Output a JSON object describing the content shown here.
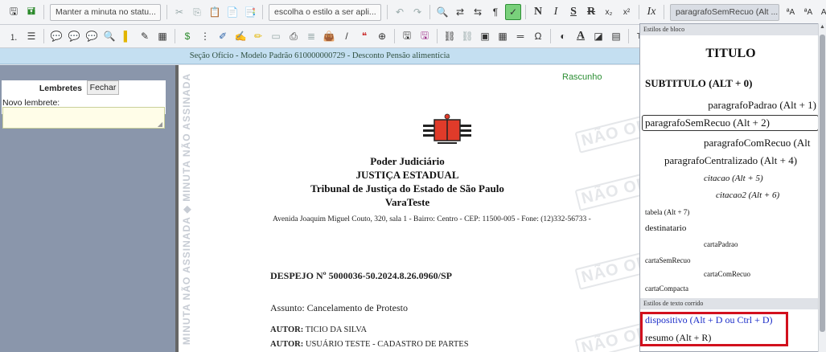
{
  "toolbar1": {
    "status_select": "Manter a minuta no statu...",
    "style_apply_select": "escolha o estilo a ser apli...",
    "paragraph_style_select": "paragrafoSemRecuo (Alt ...",
    "icons": [
      "save-icon",
      "save-alt-icon",
      "cut-icon",
      "copy-icon",
      "paste-icon",
      "paste-text-icon",
      "paste-word-icon",
      "undo-icon",
      "redo-icon",
      "find-icon",
      "replace-icon",
      "replace-all-icon",
      "format-icon",
      "spellcheck-icon",
      "bold-icon",
      "italic-icon",
      "underline-icon",
      "strike-icon",
      "subscript-icon",
      "superscript-icon",
      "clear-format-icon",
      "font-larger-icon",
      "font-smaller-icon",
      "case-icon",
      "paste-special-icon"
    ],
    "labels": {
      "bold": "N",
      "italic": "I",
      "underline": "S",
      "strike": "R",
      "sub": "x₂",
      "sup": "x²",
      "clear": "Ix",
      "font_up": "ªA",
      "font_down": "ªA",
      "case": "Aa"
    }
  },
  "toolbar2": {
    "icons": [
      "numbered-list-icon",
      "bullet-list-icon",
      "comment-icon",
      "comment-add-icon",
      "comment-remove-icon",
      "search-doc-icon",
      "highlight-icon",
      "marker-icon",
      "calculator-icon",
      "money-icon",
      "columns-icon",
      "edit-icon",
      "check-edit-icon",
      "pencil-icon",
      "page-icon",
      "print-icon",
      "table-lines-icon",
      "bag-icon",
      "brush-icon",
      "quote-icon",
      "zoom-icon",
      "save-draft-icon",
      "save-final-icon",
      "link-icon",
      "unlink-icon",
      "image-icon",
      "table-icon",
      "hr-icon",
      "special-char-icon",
      "contrast-icon",
      "text-color-icon",
      "bg-color-icon",
      "template-icon"
    ],
    "labels": {
      "omega": "Ω",
      "text_color": "A",
      "trailing": "Te"
    }
  },
  "infobar": {
    "text": "Seção Ofício - Modelo Padrão 610000000729 - Desconto Pensão alimentícia"
  },
  "reminders": {
    "title": "Lembretes",
    "close_label": "Fechar",
    "new_label": "Novo lembrete:",
    "new_value": ""
  },
  "document": {
    "status": "Rascunho",
    "watermark_stamp": "NÃO OFIC",
    "margin_watermark": "MINUTA NÃO ASSINADA  ◆  MINUTA NÃO ASSINADA",
    "court_lines": [
      "Poder Judiciário",
      "JUSTIÇA ESTADUAL",
      "Tribunal de Justiça do Estado de São Paulo",
      "VaraTeste"
    ],
    "address": "Avenida Joaquim Miguel Couto, 320, sala 1 - Bairro: Centro - CEP: 11500-005 - Fone: (12)332-56733 -",
    "process": "DESPEJO Nº 5000036-50.2024.8.26.0960/SP",
    "subject": "Assunto: Cancelamento de Protesto",
    "parties": [
      {
        "role": "AUTOR:",
        "name": " TICIO DA SILVA"
      },
      {
        "role": "AUTOR:",
        "name": " USUÁRIO TESTE - CADASTRO DE PARTES"
      }
    ]
  },
  "style_panel": {
    "block_header": "Estilos de bloco",
    "running_header": "Estilos de texto corrido",
    "block_styles": [
      "TITULO",
      "SUBTITULO (ALT + 0)",
      "paragrafoPadrao (Alt + 1)",
      "paragrafoSemRecuo (Alt + 2)",
      "paragrafoComRecuo (Alt",
      "paragrafoCentralizado (Alt + 4)",
      "citacao (Alt + 5)",
      "citacao2 (Alt + 6)",
      "tabela (Alt + 7)",
      "destinatario",
      "cartaPadrao",
      "cartaSemRecuo",
      "cartaComRecuo",
      "cartaCompacta"
    ],
    "running_styles": [
      "dispositivo (Alt + D ou Ctrl + D)",
      "resumo (Alt + R)"
    ],
    "selected": "paragrafoSemRecuo (Alt + 2)",
    "highlight_color": "#d2101d",
    "dispositivo_color": "#1a2cc8"
  }
}
